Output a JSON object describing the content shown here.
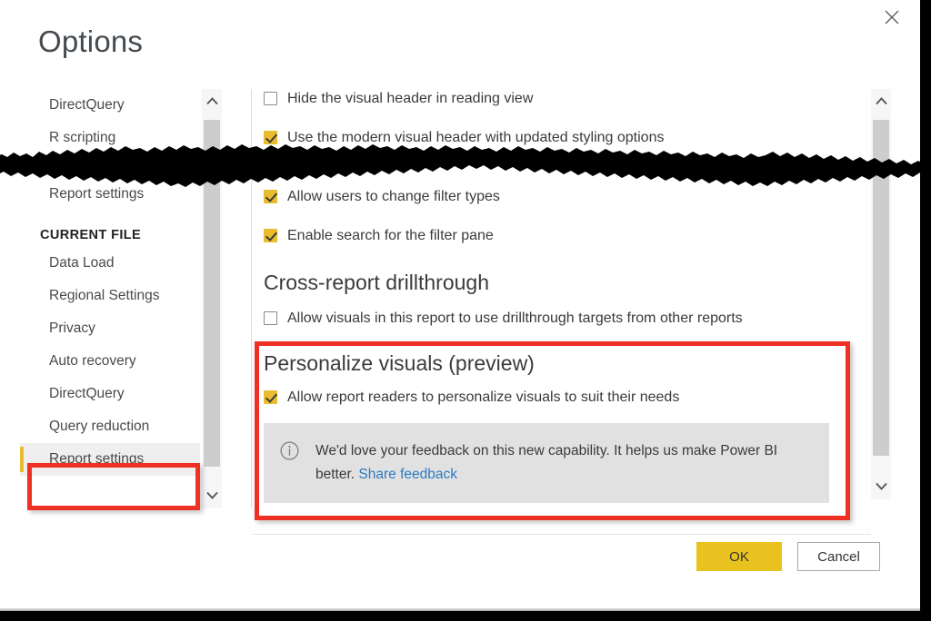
{
  "dialog": {
    "title": "Options",
    "close_icon": "close-icon"
  },
  "nav": {
    "global_items": [
      {
        "label": "DirectQuery"
      },
      {
        "label": "R scripting"
      },
      {
        "label": "Report settings"
      }
    ],
    "current_file_header": "CURRENT FILE",
    "current_file_items": [
      {
        "label": "Data Load",
        "selected": false
      },
      {
        "label": "Regional Settings",
        "selected": false
      },
      {
        "label": "Privacy",
        "selected": false
      },
      {
        "label": "Auto recovery",
        "selected": false
      },
      {
        "label": "DirectQuery",
        "selected": false
      },
      {
        "label": "Query reduction",
        "selected": false
      },
      {
        "label": "Report settings",
        "selected": true
      }
    ]
  },
  "main": {
    "checkboxes_top": [
      {
        "label": "Hide the visual header in reading view",
        "checked": false
      },
      {
        "label": "Use the modern visual header with updated styling options",
        "checked": true
      },
      {
        "label": "Allow users to change filter types",
        "checked": true
      },
      {
        "label": "Enable search for the filter pane",
        "checked": true
      }
    ],
    "cross_report": {
      "heading": "Cross-report drillthrough",
      "checkbox": {
        "label": "Allow visuals in this report to use drillthrough targets from other reports",
        "checked": false
      }
    },
    "personalize": {
      "heading": "Personalize visuals (preview)",
      "checkbox": {
        "label": "Allow report readers to personalize visuals to suit their needs",
        "checked": true
      },
      "info": {
        "icon": "info-circle-icon",
        "text": "We'd love your feedback on this new capability. It helps us make Power BI better. ",
        "link_label": "Share feedback"
      }
    }
  },
  "footer": {
    "ok_label": "OK",
    "cancel_label": "Cancel"
  },
  "scrollbars": {
    "nav": {
      "up_icon": "chevron-up-icon",
      "down_icon": "chevron-down-icon"
    },
    "main": {
      "up_icon": "chevron-up-icon",
      "down_icon": "chevron-down-icon"
    }
  },
  "colors": {
    "accent_yellow": "#e9bc2f",
    "ok_button": "#e9c21f",
    "annotation_red": "#ee3124",
    "link_blue": "#2a7bc0",
    "selected_nav_bg": "#efefef",
    "info_box_bg": "#e1e1e1"
  }
}
